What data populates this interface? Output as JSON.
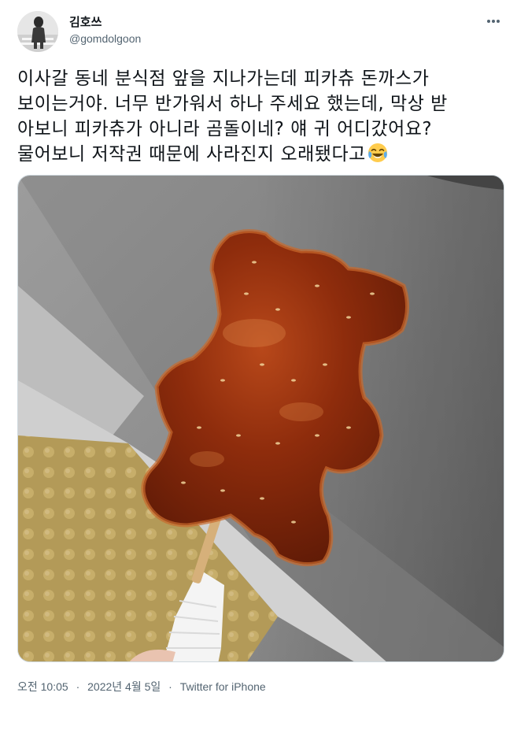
{
  "tweet": {
    "author": {
      "display_name": "김호쓰",
      "handle": "@gomdolgoon",
      "avatar_icon": "profile-avatar"
    },
    "more_icon": "more-icon",
    "text_lines": [
      "이사갈 동네 분식점 앞을 지나가는데 피카츄 돈까스가",
      "보이는거야. 너무 반가워서 하나 주세요 했는데, 막상 받",
      "아보니 피카츄가 아니라 곰돌이네? 얘 귀 어디갔어요?",
      "물어보니 저작권 때문에 사라진지 오래됐다고"
    ],
    "emoji": "face-with-tears-of-joy",
    "media": {
      "icon": "bear-cutlet-photo"
    },
    "meta": {
      "time": "오전 10:05",
      "separator": "·",
      "date": "2022년 4월 5일",
      "source": "Twitter for iPhone"
    }
  }
}
